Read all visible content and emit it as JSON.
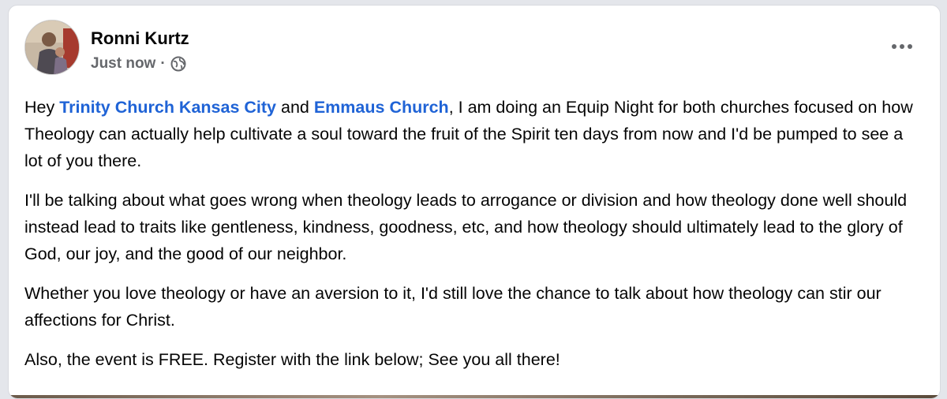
{
  "post": {
    "author": "Ronni Kurtz",
    "timestamp": "Just now",
    "separator": "·",
    "privacy_icon": "globe-icon",
    "more_icon": "more-options-icon",
    "paragraphs": [
      {
        "p1_a": "Hey ",
        "p1_link1": "Trinity Church Kansas City",
        "p1_b": " and ",
        "p1_link2": "Emmaus Church",
        "p1_c": ", I am doing an Equip Night for both churches focused on how Theology can actually help cultivate a soul toward the fruit of the Spirit ten days from now and I'd be pumped to see a lot of you there."
      }
    ],
    "p2": "I'll be talking about what goes wrong when theology leads to arrogance or division and how theology done well should instead lead to traits like gentleness, kindness, goodness, etc, and how theology should ultimately lead to the glory of God, our joy, and the good of our neighbor.",
    "p3": "Whether you love theology or have an aversion to it, I'd still love the chance to talk about how theology can stir our affections for Christ.",
    "p4": "Also, the event is FREE. Register with the link below; See you all there!"
  },
  "colors": {
    "link": "#1f63d6",
    "meta": "#65676b",
    "text": "#050505"
  }
}
